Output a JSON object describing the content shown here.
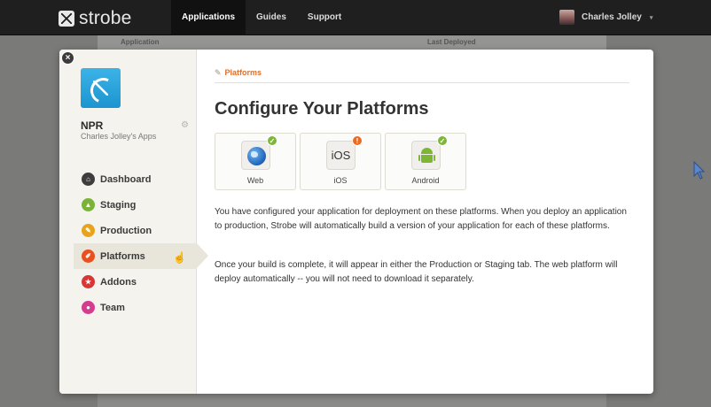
{
  "topbar": {
    "logo_text": "strobe",
    "nav": [
      "Applications",
      "Guides",
      "Support"
    ],
    "active_nav": "Applications",
    "user_name": "Charles Jolley",
    "user_caret": "▾"
  },
  "background_table": {
    "col1": "Application",
    "col2": "Last Deployed"
  },
  "modal": {
    "close_symbol": "×",
    "app": {
      "name": "NPR",
      "owner": "Charles Jolley's Apps",
      "settings_icon": "gear-icon"
    },
    "menu": [
      {
        "label": "Dashboard",
        "icon": "house-icon",
        "color": "#3d3d3d",
        "glyph": "⌂"
      },
      {
        "label": "Staging",
        "icon": "triangle-icon",
        "color": "#79b33a",
        "glyph": "▲"
      },
      {
        "label": "Production",
        "icon": "pencil-icon",
        "color": "#e9a21b",
        "glyph": "✎"
      },
      {
        "label": "Platforms",
        "icon": "pencil-ruler-icon",
        "color": "#e8501f",
        "glyph": "✐"
      },
      {
        "label": "Addons",
        "icon": "star-icon",
        "color": "#d83535",
        "glyph": "★"
      },
      {
        "label": "Team",
        "icon": "person-icon",
        "color": "#d53c8e",
        "glyph": "●"
      }
    ],
    "active_menu": "Platforms",
    "breadcrumb": "Platforms",
    "title": "Configure Your Platforms",
    "platforms": [
      {
        "label": "Web",
        "status": "ok",
        "badge_glyph": "✓"
      },
      {
        "label": "iOS",
        "status": "warn",
        "badge_glyph": "!",
        "tile_text": "iOS"
      },
      {
        "label": "Android",
        "status": "ok",
        "badge_glyph": "✓"
      }
    ],
    "paragraph1": "You have configured your application for deployment on these platforms. When you deploy an application to production, Strobe will automatically build a version of your application for each of these platforms.",
    "paragraph2": "Once your build is complete, it will appear in either the Production or Staging tab. The web platform will deploy automatically -- you will not need to download it separately."
  },
  "colors": {
    "accent": "#e06f2a",
    "ok": "#7fb538",
    "warn": "#ec6b1f"
  }
}
